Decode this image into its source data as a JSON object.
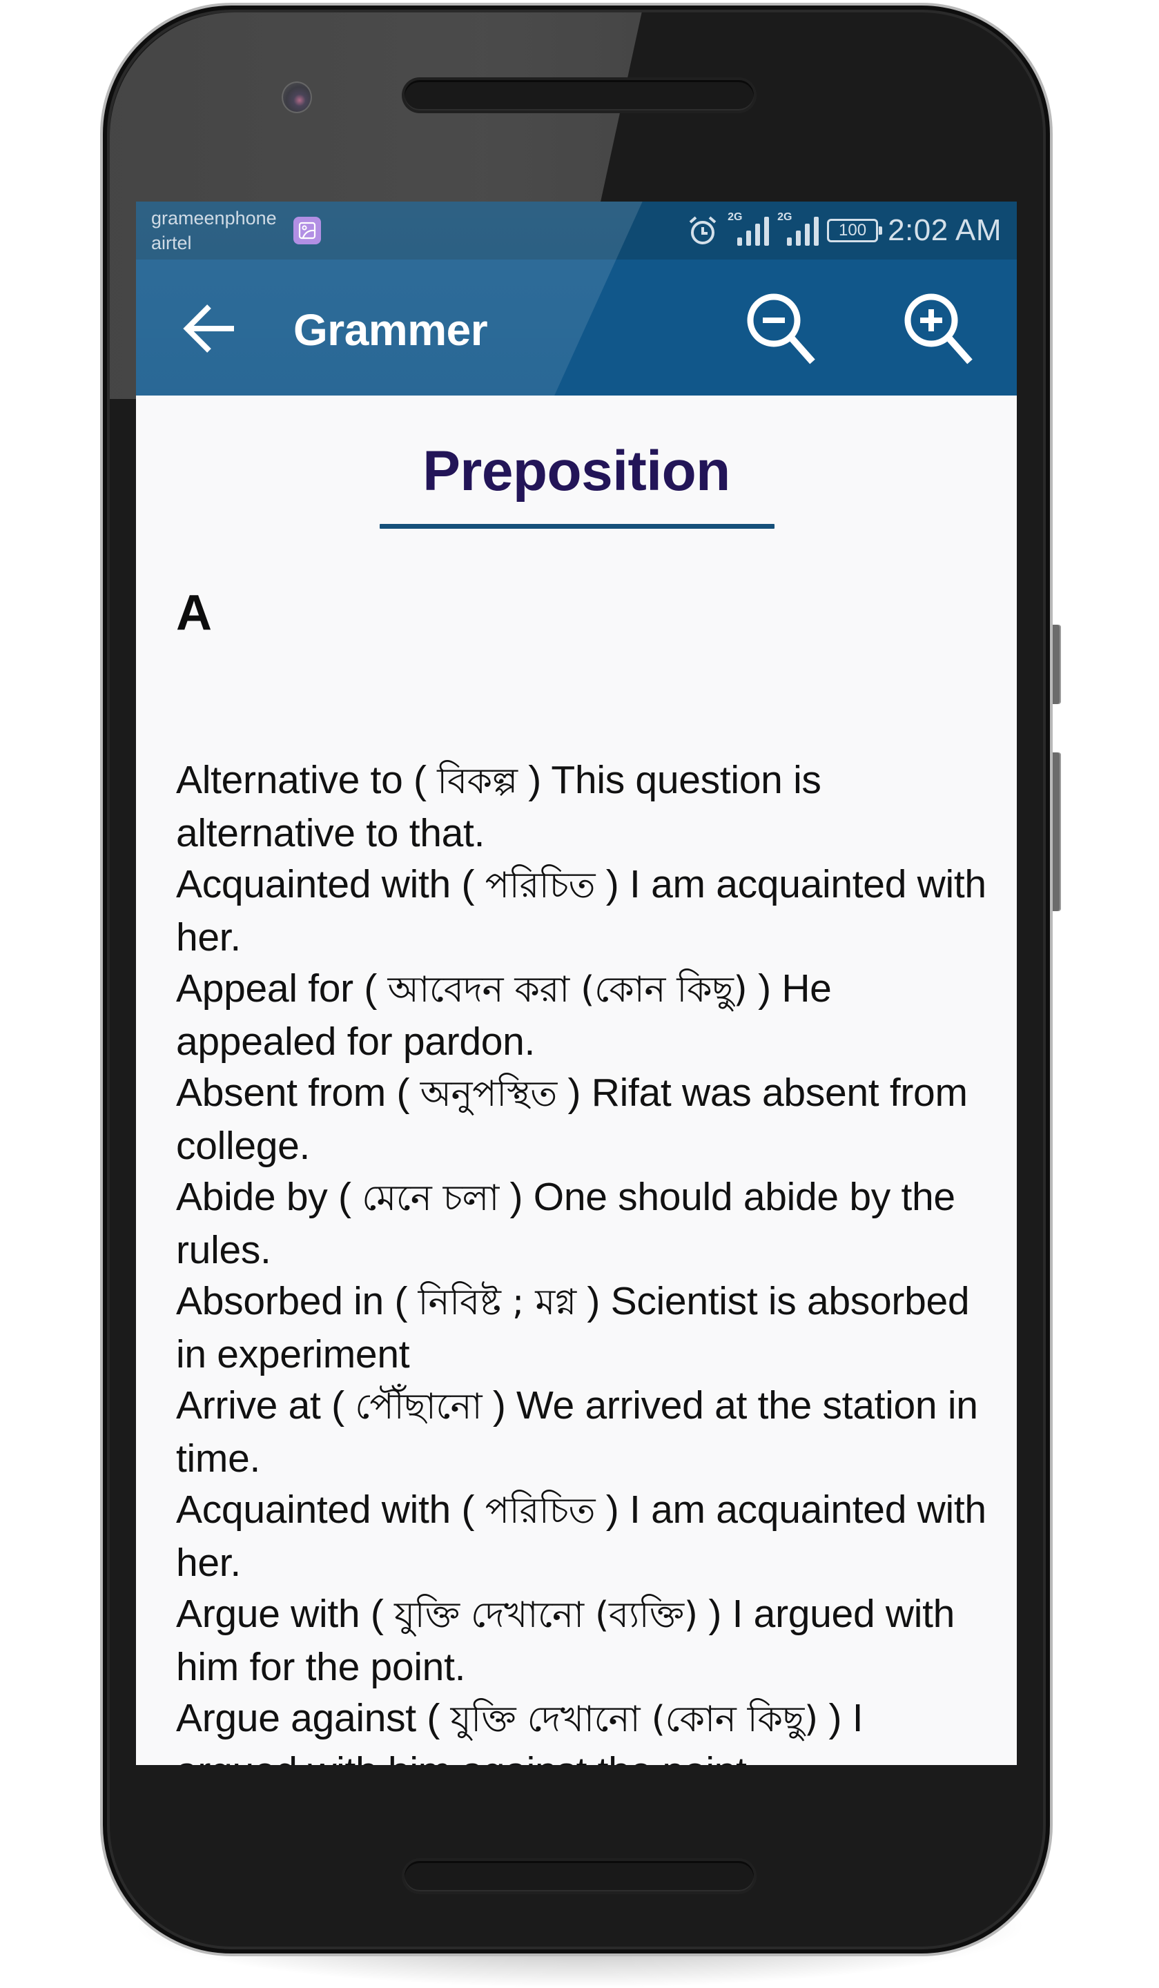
{
  "status_bar": {
    "carriers": [
      "grameenphone",
      "airtel"
    ],
    "notification_icon": "gallery-image-icon",
    "icons": [
      "alarm-icon",
      "signal-2g-icon",
      "signal-2g-icon",
      "battery-icon"
    ],
    "network_labels": [
      "2G",
      "2G"
    ],
    "battery_level": "100",
    "time": "2:02 AM"
  },
  "app_bar": {
    "back_icon": "arrow-left-icon",
    "title": "Grammer",
    "actions": [
      {
        "name": "zoom-out",
        "icon": "zoom-out-icon"
      },
      {
        "name": "zoom-in",
        "icon": "zoom-in-icon"
      }
    ],
    "color": "#11578a"
  },
  "content": {
    "heading": "Preposition",
    "heading_color": "#231558",
    "section_letter": "A",
    "entries": [
      {
        "phrase": "Alternative to",
        "meaning": "বিকল্প",
        "example": "This question is alternative to that."
      },
      {
        "phrase": "Acquainted with",
        "meaning": "পরিচিত",
        "example": "I am acquainted with her."
      },
      {
        "phrase": "Appeal for",
        "meaning": "আবেদন করা (কোন কিছু)",
        "example": "He appealed for pardon."
      },
      {
        "phrase": "Absent from",
        "meaning": "অনুপস্থিত",
        "example": "Rifat was absent from college."
      },
      {
        "phrase": "Abide by",
        "meaning": "মেনে চলা",
        "example": "One should abide by the rules."
      },
      {
        "phrase": "Absorbed in",
        "meaning": "নিবিষ্ট ; মগ্ন",
        "example": "Scientist is absorbed in experiment"
      },
      {
        "phrase": "Arrive at",
        "meaning": "পৌঁছানো",
        "example": "We arrived at the station in time."
      },
      {
        "phrase": "Acquainted with",
        "meaning": "পরিচিত",
        "example": "I am acquainted with her."
      },
      {
        "phrase": "Argue with",
        "meaning": "যুক্তি দেখানো (ব্যক্তি)",
        "example": "I argued with him for the point."
      },
      {
        "phrase": "Argue against",
        "meaning": "যুক্তি দেখানো (কোন কিছু)",
        "example": "I argued with him against the point."
      }
    ]
  }
}
